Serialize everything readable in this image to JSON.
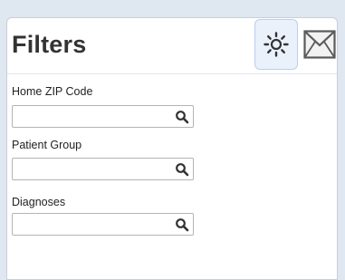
{
  "filters_panel": {
    "title": "Filters",
    "settings_icon": "gear-icon",
    "mail_icon": "envelope-icon",
    "fields": [
      {
        "label": "Home ZIP Code",
        "value": "",
        "search_icon": "search-icon"
      },
      {
        "label": "Patient Group",
        "value": "",
        "search_icon": "search-icon"
      },
      {
        "label": "Diagnoses",
        "value": "",
        "search_icon": "search-icon"
      }
    ]
  },
  "colors": {
    "page_background": "#dfe7f1",
    "panel_background": "#ffffff",
    "settings_button_background": "#eaf1fb",
    "title_text": "#333333"
  }
}
